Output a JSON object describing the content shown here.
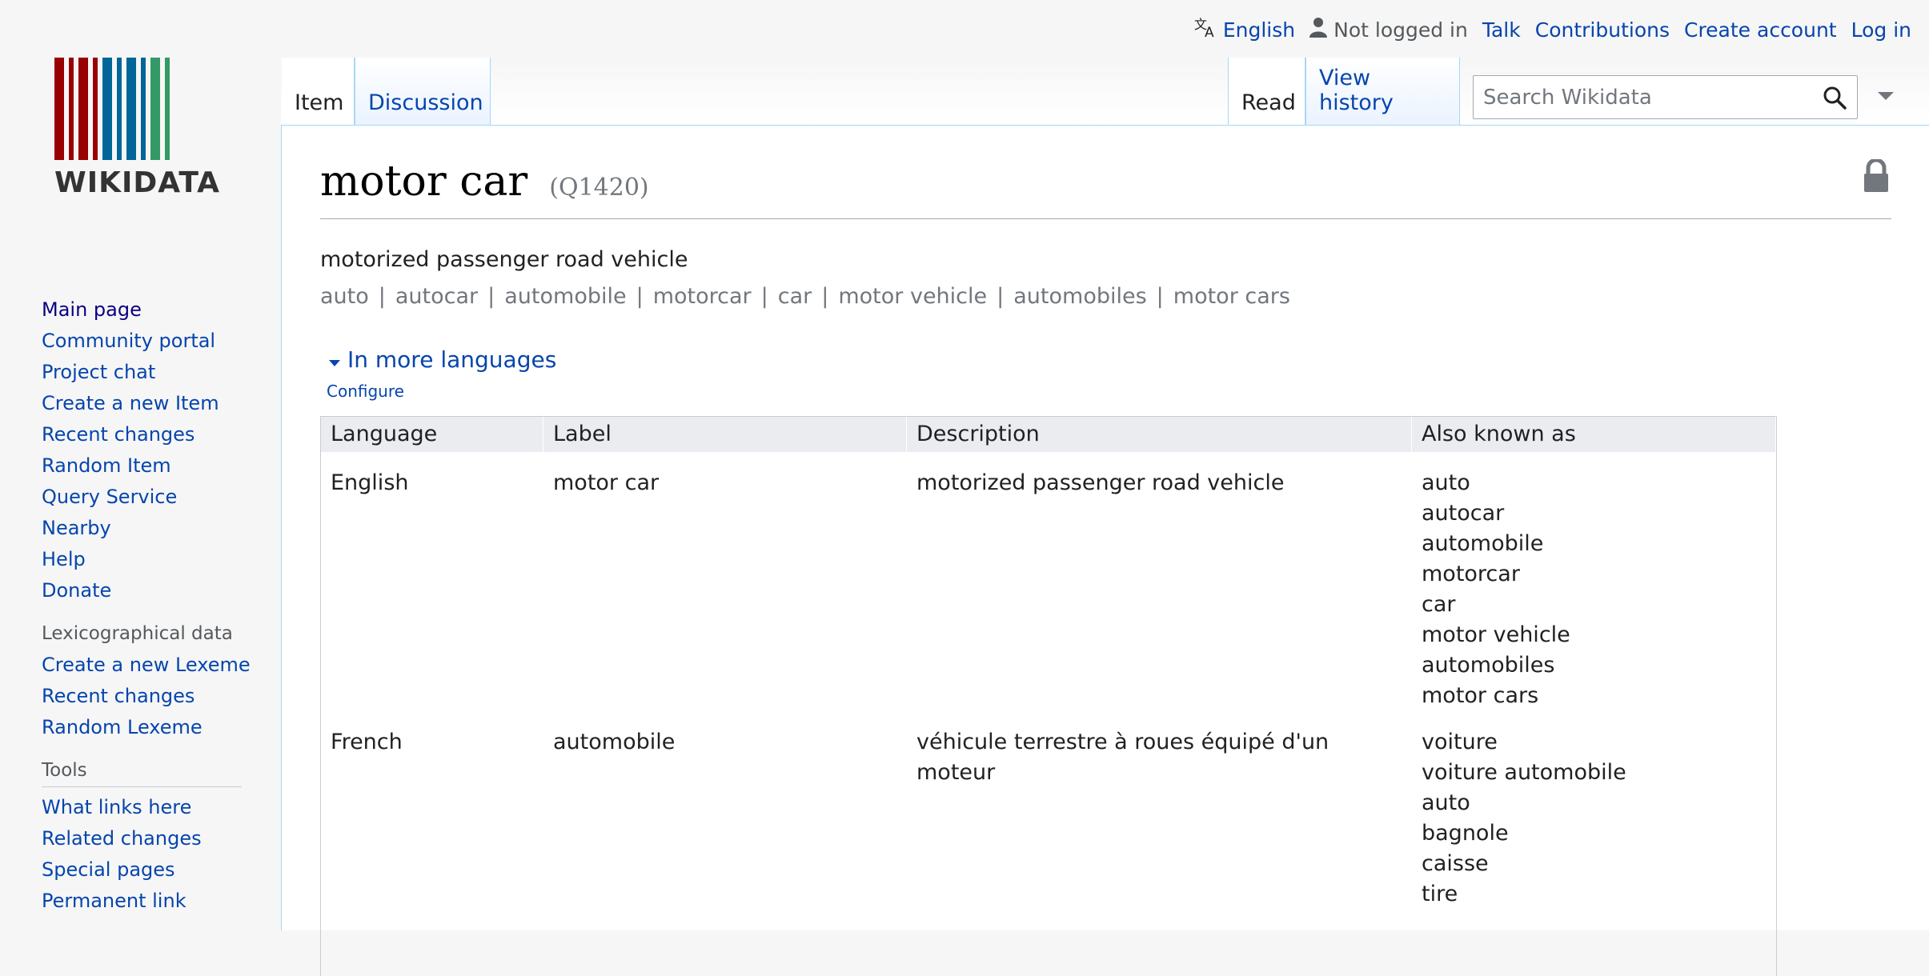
{
  "personal_tools": {
    "language": "English",
    "not_logged_in": "Not logged in",
    "talk": "Talk",
    "contributions": "Contributions",
    "create_account": "Create account",
    "log_in": "Log in"
  },
  "logo": {
    "wordmark": "WIKIDATA",
    "bar_colors": [
      "#990000",
      "#990000",
      "#990000",
      "#990000",
      "#006699",
      "#006699",
      "#006699",
      "#006699",
      "#339966",
      "#339966"
    ]
  },
  "sidebar": {
    "navigation": [
      "Main page",
      "Community portal",
      "Project chat",
      "Create a new Item",
      "Recent changes",
      "Random Item",
      "Query Service",
      "Nearby",
      "Help",
      "Donate"
    ],
    "lexicographical_heading": "Lexicographical data",
    "lexicographical": [
      "Create a new Lexeme",
      "Recent changes",
      "Random Lexeme"
    ],
    "tools_heading": "Tools",
    "tools": [
      "What links here",
      "Related changes",
      "Special pages",
      "Permanent link"
    ]
  },
  "tabs": {
    "item": "Item",
    "discussion": "Discussion",
    "read": "Read",
    "view_history": "View history"
  },
  "search": {
    "placeholder": "Search Wikidata"
  },
  "entity": {
    "label": "motor car",
    "id": "(Q1420)",
    "description": "motorized passenger road vehicle",
    "aliases": [
      "auto",
      "autocar",
      "automobile",
      "motorcar",
      "car",
      "motor vehicle",
      "automobiles",
      "motor cars"
    ]
  },
  "more_languages": {
    "toggle": "In more languages",
    "configure": "Configure"
  },
  "lang_table": {
    "headers": [
      "Language",
      "Label",
      "Description",
      "Also known as"
    ],
    "rows": [
      {
        "language": "English",
        "label": "motor car",
        "description": "motorized passenger road vehicle",
        "aliases": [
          "auto",
          "autocar",
          "automobile",
          "motorcar",
          "car",
          "motor vehicle",
          "automobiles",
          "motor cars"
        ]
      },
      {
        "language": "French",
        "label": "automobile",
        "description": "véhicule terrestre à roues équipé d'un moteur",
        "aliases": [
          "voiture",
          "voiture automobile",
          "auto",
          "bagnole",
          "caisse",
          "tire"
        ]
      }
    ]
  },
  "colors": {
    "link": "#0645ad",
    "visited_link": "#0b0080",
    "tab_border": "#a7d7f9",
    "muted": "#72777d"
  }
}
